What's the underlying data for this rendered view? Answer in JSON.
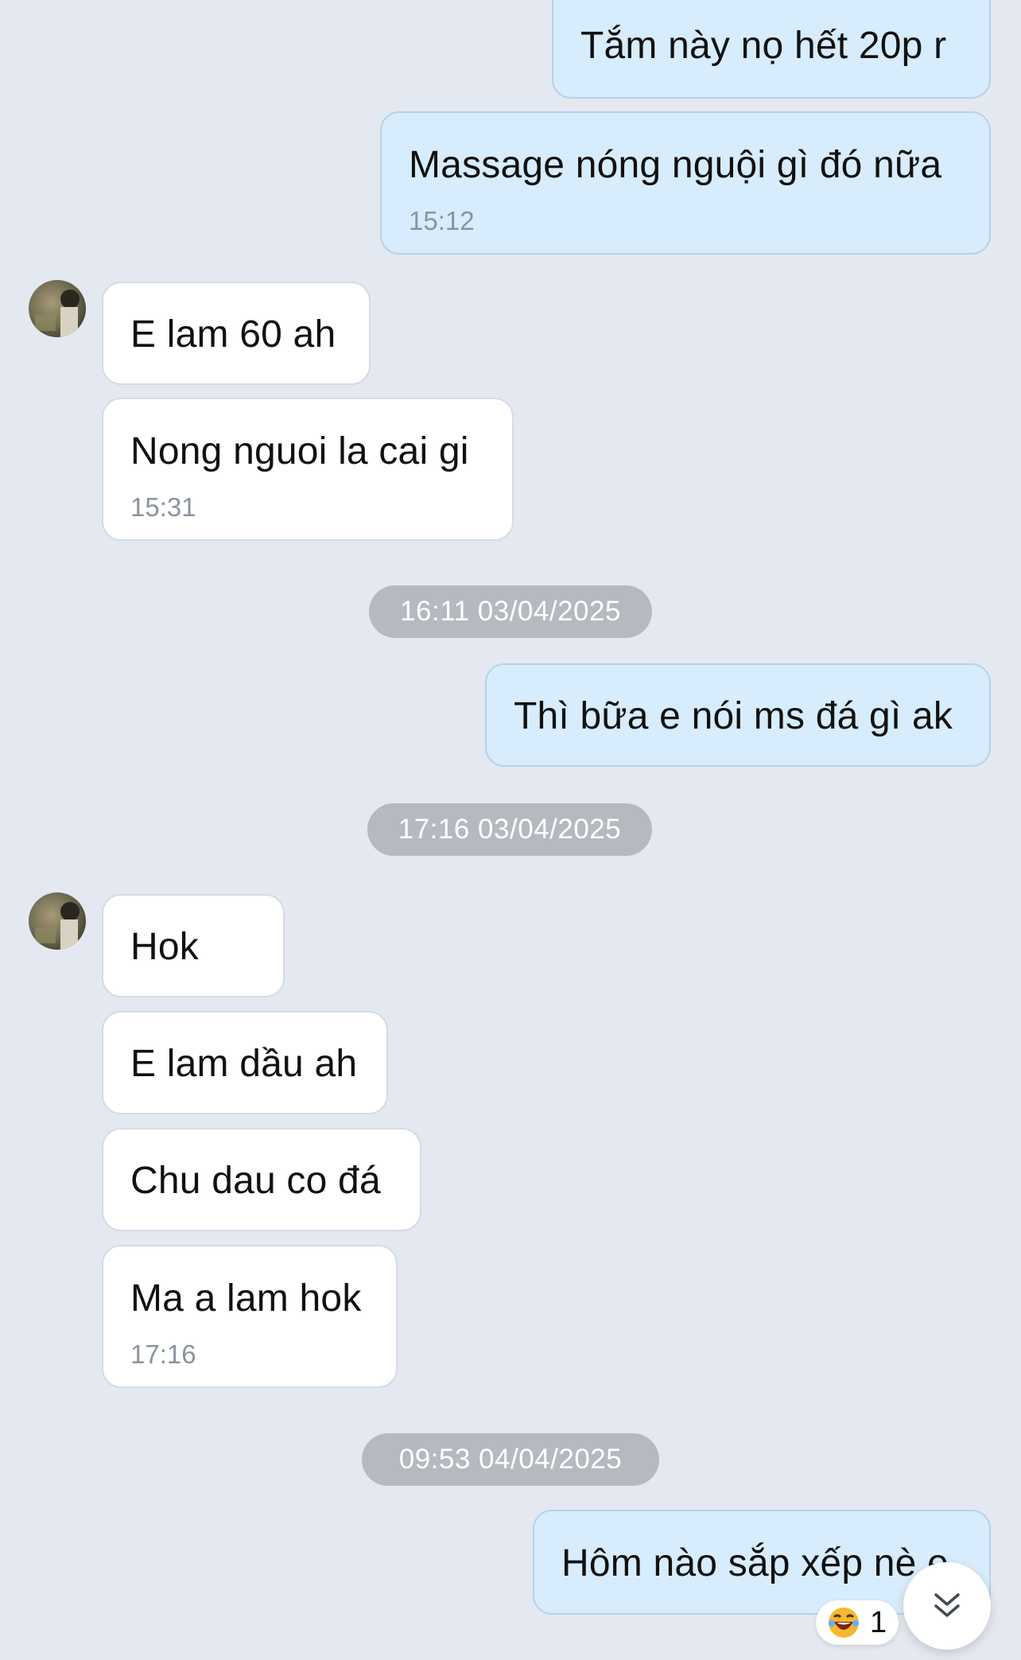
{
  "messages": [
    {
      "side": "out",
      "text": "Tắm này nọ hết 20p r",
      "time": ""
    },
    {
      "side": "out",
      "text": "Massage nóng nguội gì đó nữa",
      "time": "15:12"
    },
    {
      "side": "in",
      "text": "E lam 60 ah",
      "time": ""
    },
    {
      "side": "in",
      "text": "Nong nguoi la cai gi",
      "time": "15:31"
    },
    {
      "side": "out",
      "text": "Thì bữa e nói ms đá gì ak",
      "time": ""
    },
    {
      "side": "in",
      "text": "Hok",
      "time": ""
    },
    {
      "side": "in",
      "text": "E lam dầu ah",
      "time": ""
    },
    {
      "side": "in",
      "text": "Chu dau co đá",
      "time": ""
    },
    {
      "side": "in",
      "text": "Ma a lam hok",
      "time": "17:16"
    },
    {
      "side": "out",
      "text": "Hôm nào sắp xếp nè e",
      "time": ""
    }
  ],
  "date_separators": [
    "16:11 03/04/2025",
    "17:16 03/04/2025",
    "09:53 04/04/2025"
  ],
  "reaction": {
    "icon": "laughing-face-icon",
    "count": "1"
  },
  "colors": {
    "background": "#e4e8f1",
    "outgoing_bubble": "#d7ecfc",
    "incoming_bubble": "#ffffff",
    "date_chip": "#b5b9c0",
    "timestamp": "#8b93a0"
  },
  "icons": {
    "scroll_down": "double-chevron-down-icon",
    "avatar": "contact-avatar"
  }
}
